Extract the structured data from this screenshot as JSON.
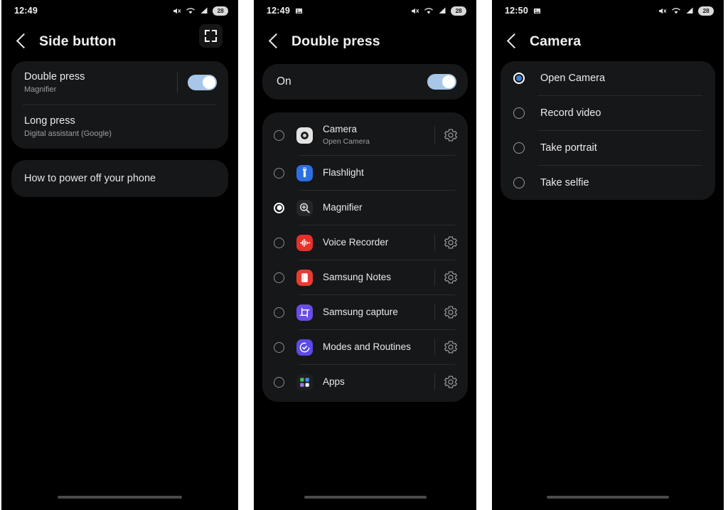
{
  "colors": {
    "screen_bg": "#000000",
    "card_bg": "#161719",
    "toggle_on": "#a8c7e8",
    "radio_selected": "#3b82d6",
    "divider": "#2a2b2e",
    "text_primary": "#ececec",
    "text_secondary": "#9d9fa3",
    "page_bg": "#ffffff"
  },
  "panel1": {
    "status": {
      "time": "12:49",
      "icons": [
        "mute-icon",
        "wifi-icon",
        "signal-icon"
      ],
      "battery_level": "28"
    },
    "appbar": {
      "back": "back-chevron-icon",
      "title": "Side button",
      "expand_button": "fullscreen-icon"
    },
    "prefs": [
      {
        "title": "Double press",
        "sub": "Magnifier",
        "toggle": true,
        "toggle_state": "on"
      },
      {
        "title": "Long press",
        "sub": "Digital assistant (Google)",
        "toggle": false
      }
    ],
    "link": "How to power off your phone"
  },
  "panel2": {
    "status": {
      "time": "12:49",
      "notification_icon": "image-icon",
      "icons": [
        "mute-icon",
        "wifi-icon",
        "signal-icon"
      ],
      "battery_level": "28"
    },
    "appbar": {
      "back": "back-chevron-icon",
      "title": "Double press"
    },
    "master_toggle": {
      "label": "On",
      "state": "on"
    },
    "apps": [
      {
        "name": "Camera",
        "sub": "Open Camera",
        "selected": false,
        "gear": true,
        "icon": "camera-app-icon"
      },
      {
        "name": "Flashlight",
        "sub": "",
        "selected": false,
        "gear": false,
        "icon": "flashlight-app-icon"
      },
      {
        "name": "Magnifier",
        "sub": "",
        "selected": true,
        "gear": false,
        "icon": "magnifier-app-icon"
      },
      {
        "name": "Voice Recorder",
        "sub": "",
        "selected": false,
        "gear": true,
        "icon": "voice-recorder-app-icon"
      },
      {
        "name": "Samsung Notes",
        "sub": "",
        "selected": false,
        "gear": true,
        "icon": "samsung-notes-app-icon"
      },
      {
        "name": "Samsung capture",
        "sub": "",
        "selected": false,
        "gear": true,
        "icon": "samsung-capture-app-icon"
      },
      {
        "name": "Modes and Routines",
        "sub": "",
        "selected": false,
        "gear": true,
        "icon": "modes-routines-app-icon"
      },
      {
        "name": "Apps",
        "sub": "",
        "selected": false,
        "gear": true,
        "icon": "apps-grid-app-icon"
      }
    ]
  },
  "panel3": {
    "status": {
      "time": "12:50",
      "notification_icon": "image-icon",
      "icons": [
        "mute-icon",
        "wifi-icon",
        "signal-icon"
      ],
      "battery_level": "28"
    },
    "appbar": {
      "back": "back-chevron-icon",
      "title": "Camera"
    },
    "options": [
      {
        "label": "Open Camera",
        "selected": true
      },
      {
        "label": "Record video",
        "selected": false
      },
      {
        "label": "Take portrait",
        "selected": false
      },
      {
        "label": "Take selfie",
        "selected": false
      }
    ]
  }
}
